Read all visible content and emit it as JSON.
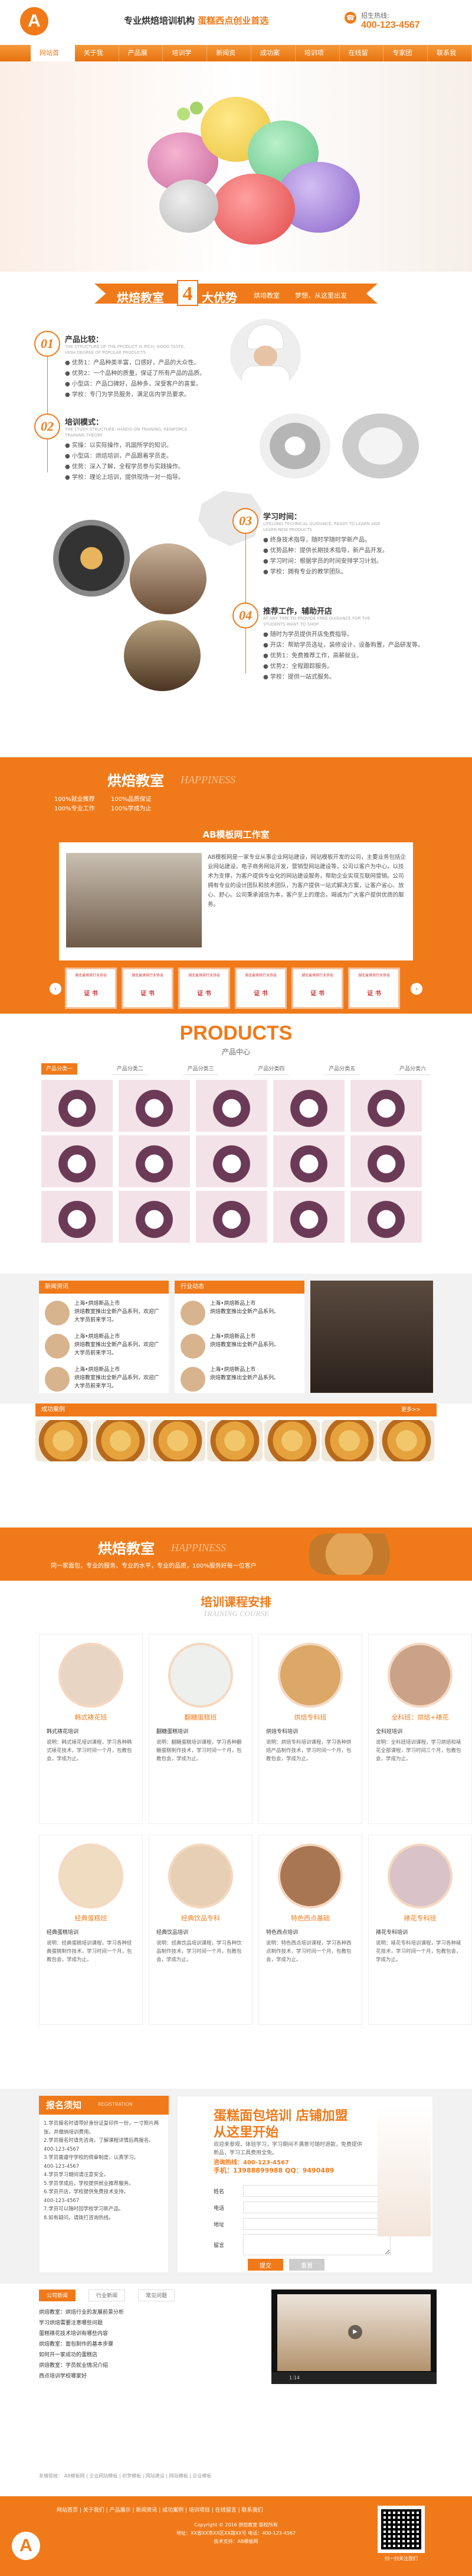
{
  "header": {
    "logo": "A",
    "slogan_a": "专业烘焙培训机构",
    "slogan_b": "蛋糕西点创业首选",
    "hotline_label": "招生热线:",
    "hotline": "400-123-4567"
  },
  "nav": [
    "网站首页",
    "关于我们",
    "产品展示",
    "培训学校",
    "新闻资讯",
    "成功案例",
    "培训项目",
    "在线留言",
    "专家团队",
    "联系我们"
  ],
  "adv": {
    "title_a": "烘焙教室",
    "num": "4",
    "title_b": "大优势",
    "tag1": "烘培教室",
    "tag2": "梦想，从这里出发",
    "items": [
      {
        "n": "01",
        "h": "产品比较：",
        "en": "THE STRUCTURE OF THE PRODUCT IS RICH, GOOD TASTE, HIGH DEGREE OF POPULAR PRODUCTS",
        "lines": [
          "● 优势1：产品种类丰富，口感好，产品的大众性。",
          "● 优势2：一个品种的质量，保证了所有产品的品质。",
          "● 小型店：产品口碑好，品种多，深受客户的喜爱。",
          "● 学校：专门为学员服务，满足店内学员要求。"
        ]
      },
      {
        "n": "02",
        "h": "培训模式：",
        "en": "THE STUDY STRUCTURE: HANDS-ON TRAINING, REINFORCE TRAINING THEORY",
        "lines": [
          "● 实操：以实际操作，巩固所学的知识。",
          "● 小型店：烘焙培训，产品跟着学员走。",
          "● 优势：深入了解，全程学员参与实践操作。",
          "● 学校：理论上培训，提供现场一对一指导。"
        ]
      },
      {
        "n": "03",
        "h": "学习时间：",
        "en": "LIFELONG TECHNICAL GUIDANCE, READY TO LEARN AND LEARN NEW PRODUCTS",
        "lines": [
          "● 终身技术指导，随时学随时学新产品。",
          "● 优势品种：提供长期技术指导，新产品开发。",
          "● 学习时间：根据学员的时间安排学习计划。",
          "● 学校：拥有专业的教学团队。"
        ]
      },
      {
        "n": "04",
        "h": "推荐工作，辅助开店",
        "en": "AT ANY TIME TO PROVIDE FREE GUIDANCE FOR THE STUDENTS WANT TO SHOP",
        "lines": [
          "● 随时为学员提供开店免费指导。",
          "● 开店：帮助学员选址，装修设计，设备购置，产品研发等。",
          "● 优势1：免费推荐工作，高薪就业。",
          "● 优势2：全程跟踪服务。",
          "● 学校：提供一站式服务。"
        ]
      }
    ]
  },
  "band1": {
    "title": "烘焙教室",
    "en": "HAPPINESS",
    "items": [
      "100%就业推荐",
      "100%品质保证",
      "100%专业工作",
      "100%学成为止"
    ]
  },
  "ab": {
    "title": "AB模板网工作室",
    "text": "AB模板网是一家专业从事企业网站建设，网站模板开发的公司，主要业务包括企业网站建设，电子商务网站开发，营销型网站建设等，公司以客户为中心，以技术为支撑，为客户提供专业化的网站建设服务，帮助企业实现互联网营销。公司拥有专业的设计团队和技术团队，为客户提供一站式解决方案，让客户省心、放心、舒心。公司秉承诚信为本，客户至上的理念，竭诚为广大客户提供优质的服务。",
    "certs": [
      {
        "t": "湖北省烘焙行业协会",
        "n": "证 书"
      },
      {
        "t": "湖北省烘焙行业协会",
        "n": "证 书"
      },
      {
        "t": "湖北省烘焙行业协会",
        "n": "证 书"
      },
      {
        "t": "湖北省烘焙行业协会",
        "n": "证 书"
      },
      {
        "t": "湖北省烘焙行业协会",
        "n": "证 书"
      },
      {
        "t": "湖北省烘焙行业协会",
        "n": "证 书"
      }
    ]
  },
  "products": {
    "en": "PRODUCTS",
    "cn": "产品中心",
    "tabs": [
      "产品分类一",
      "产品分类二",
      "产品分类三",
      "产品分类四",
      "产品分类五",
      "产品分类六"
    ]
  },
  "news": {
    "h1": "新闻资讯",
    "h2": "行业动态",
    "items1": [
      {
        "t": "上海•烘焙新品上市",
        "d": "烘焙教室推出全新产品系列，欢迎广大学员前来学习。"
      },
      {
        "t": "上海•烘焙新品上市",
        "d": "烘焙教室推出全新产品系列，欢迎广大学员前来学习。"
      },
      {
        "t": "上海•烘焙新品上市",
        "d": "烘焙教室推出全新产品系列，欢迎广大学员前来学习。"
      }
    ],
    "items2": [
      {
        "t": "上海•烘焙新品上市",
        "d": "烘焙教室推出全新产品系列。"
      },
      {
        "t": "上海•烘焙新品上市",
        "d": "烘焙教室推出全新产品系列。"
      },
      {
        "t": "上海•烘焙新品上市",
        "d": "烘焙教室推出全新产品系列。"
      }
    ]
  },
  "cases": {
    "title": "成功案例",
    "more": "更多>>"
  },
  "band2": {
    "title": "烘焙教室",
    "en": "HAPPINESS",
    "sub": "同一家面包，专业的服务，专业的水平，专业的品质，100%服务好每一位客户"
  },
  "training": {
    "title": "培训课程安排",
    "en": "TRAINING COURSE",
    "courses": [
      {
        "name": "韩式裱花班",
        "sub": "韩式裱花培训",
        "desc": "说明：韩式裱花培训课程，学习各种韩式裱花技术，学习时间一个月，包教包会，学成为止。"
      },
      {
        "name": "翻糖蛋糕班",
        "sub": "翻糖蛋糕培训",
        "desc": "说明：翻糖蛋糕培训课程，学习各种翻糖蛋糕制作技术，学习时间一个月，包教包会，学成为止。"
      },
      {
        "name": "烘焙专科班",
        "sub": "烘焙专科培训",
        "desc": "说明：烘焙专科培训课程，学习各种烘焙产品制作技术，学习时间一个月，包教包会，学成为止。"
      },
      {
        "name": "全科班：烘焙+裱花",
        "sub": "全科班培训",
        "desc": "说明：全科班培训课程，学习烘焙和裱花全部课程，学习时间三个月，包教包会，学成为止。"
      },
      {
        "name": "经典蛋糕班",
        "sub": "经典蛋糕培训",
        "desc": "说明：经典蛋糕培训课程，学习各种经典蛋糕制作技术，学习时间一个月，包教包会，学成为止。"
      },
      {
        "name": "经典饮品专科",
        "sub": "经典饮品培训",
        "desc": "说明：经典饮品培训课程，学习各种饮品制作技术，学习时间一个月，包教包会，学成为止。"
      },
      {
        "name": "特色西点基础",
        "sub": "特色西点培训",
        "desc": "说明：特色西点培训课程，学习各种西点制作技术，学习时间一个月，包教包会，学成为止。"
      },
      {
        "name": "裱花专科班",
        "sub": "裱花专科培训",
        "desc": "说明：裱花专科培训课程，学习各种裱花技术，学习时间一个月，包教包会，学成为止。"
      }
    ]
  },
  "signup": {
    "title": "报名须知",
    "en": "REGISTRATION",
    "text": [
      "1.学员报名时请带好身份证复印件一份，一寸照片两张，并缴纳培训费用。",
      "2.学员报名时请先咨询，了解课程详情后再报名。",
      "400-123-4567",
      "3.学员需遵守学校的规章制度，认真学习。",
      "400-123-4567",
      "4.学员学习期间请注意安全。",
      "5.学员学成后，学校提供就业推荐服务。",
      "6.学员开店，学校提供免费技术支持。",
      "400-123-4567",
      "7.学员可以随时回学校学习新产品。",
      "8.如有疑问，请拨打咨询热线。"
    ],
    "r_title1": "蛋糕面包培训 店铺加盟",
    "r_title2": "从这里开始",
    "r_desc": "欢迎来参观，体验学习，学习期间不满意可随时退款，免费提供新品，学习工具费用全免。",
    "r_tel": "咨询热线：400-123-4567",
    "r_phone": "手机：13988899988 QQ：9490489",
    "labels": [
      "姓名",
      "电话",
      "地址",
      "留言"
    ],
    "submit": "提交",
    "reset": "重置"
  },
  "bottom": {
    "tabs": [
      "公司新闻",
      "行业新闻",
      "常见问题"
    ],
    "news": [
      "烘焙教室：烘焙行业的发展前景分析",
      "学习烘焙需要注意哪些问题",
      "蛋糕裱花技术培训有哪些内容",
      "烘焙教室：面包制作的基本步骤",
      "如何开一家成功的蛋糕店",
      "烘焙教室：学员就业情况介绍",
      "西点培训学校哪家好"
    ],
    "video_time": "1:14"
  },
  "footlinks": [
    "友情链接：",
    "AB模板网",
    "企业网站模板",
    "织梦模板",
    "网站建设",
    "网站模板",
    "企业模板"
  ],
  "footer": {
    "nav": [
      "网站首页",
      "关于我们",
      "产品展示",
      "新闻资讯",
      "成功案例",
      "培训项目",
      "在线留言",
      "联系我们"
    ],
    "copy1": "Copyright © 2016 烘焙教室 版权所有",
    "copy2": "地址：XX省XX市XX区XX路XX号  电话：400-123-4567",
    "copy3": "技术支持：AB模板网",
    "qr": "扫一扫关注我们"
  }
}
